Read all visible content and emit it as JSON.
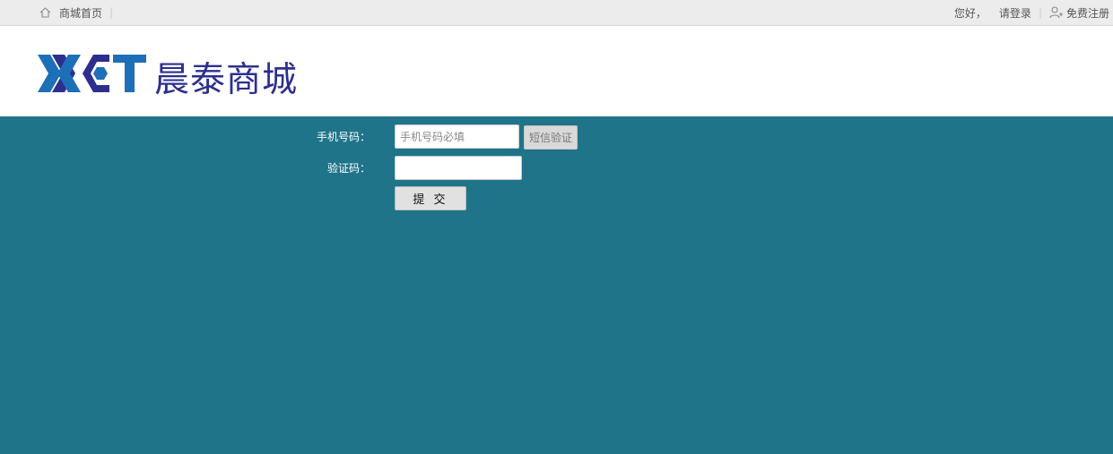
{
  "topbar": {
    "home_link": "商城首页",
    "greeting": "您好，",
    "login_link": "请登录",
    "register_link": "免费注册",
    "home_icon": "home-icon",
    "user_icon": "user-plus-icon"
  },
  "header": {
    "logo_mark": "XCT",
    "logo_text": "晨泰商城",
    "brand_color": "#2d2f8e",
    "accent_color": "#1d6fb8"
  },
  "form": {
    "phone_label": "手机号码：",
    "phone_placeholder": "手机号码必填",
    "phone_value": "",
    "sms_button": "短信验证",
    "code_label": "验证码：",
    "code_value": "",
    "submit_button": "提 交"
  },
  "colors": {
    "main_bg": "#1f7489",
    "topbar_bg": "#ececec"
  }
}
